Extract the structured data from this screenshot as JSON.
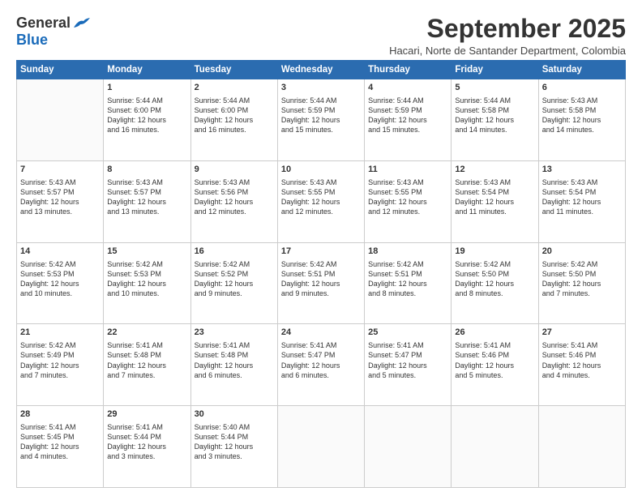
{
  "header": {
    "logo_general": "General",
    "logo_blue": "Blue",
    "month_title": "September 2025",
    "location": "Hacari, Norte de Santander Department, Colombia"
  },
  "days_of_week": [
    "Sunday",
    "Monday",
    "Tuesday",
    "Wednesday",
    "Thursday",
    "Friday",
    "Saturday"
  ],
  "weeks": [
    [
      {
        "day": "",
        "info": ""
      },
      {
        "day": "1",
        "info": "Sunrise: 5:44 AM\nSunset: 6:00 PM\nDaylight: 12 hours\nand 16 minutes."
      },
      {
        "day": "2",
        "info": "Sunrise: 5:44 AM\nSunset: 6:00 PM\nDaylight: 12 hours\nand 16 minutes."
      },
      {
        "day": "3",
        "info": "Sunrise: 5:44 AM\nSunset: 5:59 PM\nDaylight: 12 hours\nand 15 minutes."
      },
      {
        "day": "4",
        "info": "Sunrise: 5:44 AM\nSunset: 5:59 PM\nDaylight: 12 hours\nand 15 minutes."
      },
      {
        "day": "5",
        "info": "Sunrise: 5:44 AM\nSunset: 5:58 PM\nDaylight: 12 hours\nand 14 minutes."
      },
      {
        "day": "6",
        "info": "Sunrise: 5:43 AM\nSunset: 5:58 PM\nDaylight: 12 hours\nand 14 minutes."
      }
    ],
    [
      {
        "day": "7",
        "info": "Sunrise: 5:43 AM\nSunset: 5:57 PM\nDaylight: 12 hours\nand 13 minutes."
      },
      {
        "day": "8",
        "info": "Sunrise: 5:43 AM\nSunset: 5:57 PM\nDaylight: 12 hours\nand 13 minutes."
      },
      {
        "day": "9",
        "info": "Sunrise: 5:43 AM\nSunset: 5:56 PM\nDaylight: 12 hours\nand 12 minutes."
      },
      {
        "day": "10",
        "info": "Sunrise: 5:43 AM\nSunset: 5:55 PM\nDaylight: 12 hours\nand 12 minutes."
      },
      {
        "day": "11",
        "info": "Sunrise: 5:43 AM\nSunset: 5:55 PM\nDaylight: 12 hours\nand 12 minutes."
      },
      {
        "day": "12",
        "info": "Sunrise: 5:43 AM\nSunset: 5:54 PM\nDaylight: 12 hours\nand 11 minutes."
      },
      {
        "day": "13",
        "info": "Sunrise: 5:43 AM\nSunset: 5:54 PM\nDaylight: 12 hours\nand 11 minutes."
      }
    ],
    [
      {
        "day": "14",
        "info": "Sunrise: 5:42 AM\nSunset: 5:53 PM\nDaylight: 12 hours\nand 10 minutes."
      },
      {
        "day": "15",
        "info": "Sunrise: 5:42 AM\nSunset: 5:53 PM\nDaylight: 12 hours\nand 10 minutes."
      },
      {
        "day": "16",
        "info": "Sunrise: 5:42 AM\nSunset: 5:52 PM\nDaylight: 12 hours\nand 9 minutes."
      },
      {
        "day": "17",
        "info": "Sunrise: 5:42 AM\nSunset: 5:51 PM\nDaylight: 12 hours\nand 9 minutes."
      },
      {
        "day": "18",
        "info": "Sunrise: 5:42 AM\nSunset: 5:51 PM\nDaylight: 12 hours\nand 8 minutes."
      },
      {
        "day": "19",
        "info": "Sunrise: 5:42 AM\nSunset: 5:50 PM\nDaylight: 12 hours\nand 8 minutes."
      },
      {
        "day": "20",
        "info": "Sunrise: 5:42 AM\nSunset: 5:50 PM\nDaylight: 12 hours\nand 7 minutes."
      }
    ],
    [
      {
        "day": "21",
        "info": "Sunrise: 5:42 AM\nSunset: 5:49 PM\nDaylight: 12 hours\nand 7 minutes."
      },
      {
        "day": "22",
        "info": "Sunrise: 5:41 AM\nSunset: 5:48 PM\nDaylight: 12 hours\nand 7 minutes."
      },
      {
        "day": "23",
        "info": "Sunrise: 5:41 AM\nSunset: 5:48 PM\nDaylight: 12 hours\nand 6 minutes."
      },
      {
        "day": "24",
        "info": "Sunrise: 5:41 AM\nSunset: 5:47 PM\nDaylight: 12 hours\nand 6 minutes."
      },
      {
        "day": "25",
        "info": "Sunrise: 5:41 AM\nSunset: 5:47 PM\nDaylight: 12 hours\nand 5 minutes."
      },
      {
        "day": "26",
        "info": "Sunrise: 5:41 AM\nSunset: 5:46 PM\nDaylight: 12 hours\nand 5 minutes."
      },
      {
        "day": "27",
        "info": "Sunrise: 5:41 AM\nSunset: 5:46 PM\nDaylight: 12 hours\nand 4 minutes."
      }
    ],
    [
      {
        "day": "28",
        "info": "Sunrise: 5:41 AM\nSunset: 5:45 PM\nDaylight: 12 hours\nand 4 minutes."
      },
      {
        "day": "29",
        "info": "Sunrise: 5:41 AM\nSunset: 5:44 PM\nDaylight: 12 hours\nand 3 minutes."
      },
      {
        "day": "30",
        "info": "Sunrise: 5:40 AM\nSunset: 5:44 PM\nDaylight: 12 hours\nand 3 minutes."
      },
      {
        "day": "",
        "info": ""
      },
      {
        "day": "",
        "info": ""
      },
      {
        "day": "",
        "info": ""
      },
      {
        "day": "",
        "info": ""
      }
    ]
  ]
}
